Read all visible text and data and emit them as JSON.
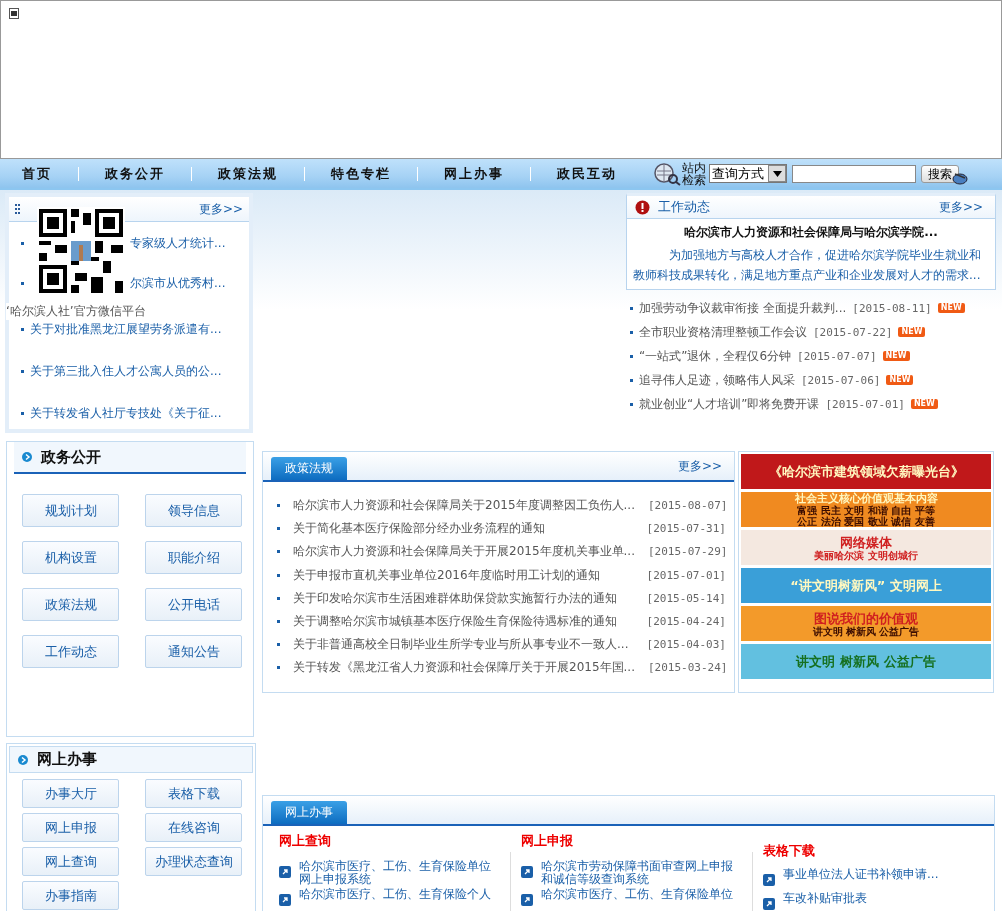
{
  "nav": {
    "items": [
      {
        "label": "首页",
        "selected": false
      },
      {
        "label": "政务公开",
        "selected": false
      },
      {
        "label": "政策法规",
        "selected": false
      },
      {
        "label": "特色专栏",
        "selected": false
      },
      {
        "label": "网上办事",
        "selected": false
      },
      {
        "label": "政民互动",
        "selected": false
      }
    ],
    "search": {
      "label": "站内检索",
      "select": "查询方式",
      "button": "搜索"
    }
  },
  "news": {
    "more": "更多>>",
    "qr_caption": "‘哈尔滨人社’官方微信平台",
    "items": [
      {
        "kind": "partly_hidden",
        "text": "专家级人才统计..."
      },
      {
        "kind": "partly_hidden",
        "text": "尔滨市从优秀村..."
      },
      {
        "kind": "link",
        "text": "关于对批准黑龙江展望劳务派遣有..."
      },
      {
        "kind": "link",
        "text": "关于第三批入住人才公寓人员的公..."
      },
      {
        "kind": "link",
        "text": "关于转发省人社厅专技处《关于征..."
      }
    ]
  },
  "work": {
    "title": "工作动态",
    "more": "更多>>",
    "headline": "哈尔滨市人力资源和社会保障局与哈尔滨学院...",
    "summary": "为加强地方与高校人才合作，促进哈尔滨学院毕业生就业和教师科技成果转化，满足地方重点产业和企业发展对人才的需求...",
    "items": [
      {
        "title": "加强劳动争议裁审衔接 全面提升裁判...",
        "date": "[2015-08-11]",
        "new": true,
        "badge": "NEW"
      },
      {
        "title": "全市职业资格清理整顿工作会议",
        "date": "[2015-07-22]",
        "new": true,
        "badge": "NEW"
      },
      {
        "title": "“一站式”退休，全程仅6分钟",
        "date": "[2015-07-07]",
        "new": true,
        "badge": "NEW"
      },
      {
        "title": "追寻伟人足迹，领略伟人风采",
        "date": "[2015-07-06]",
        "new": true,
        "badge": "NEW"
      },
      {
        "title": "就业创业“人才培训”即将免费开课",
        "date": "[2015-07-01]",
        "new": true,
        "badge": "NEW"
      }
    ]
  },
  "gov": {
    "title": "政务公开",
    "buttons": [
      "规划计划",
      "领导信息",
      "机构设置",
      "职能介绍",
      "政策法规",
      "公开电话",
      "工作动态",
      "通知公告"
    ]
  },
  "online_left": {
    "title": "网上办事",
    "buttons": [
      "办事大厅",
      "表格下载",
      "网上申报",
      "在线咨询",
      "网上查询",
      "办理状态查询",
      "办事指南"
    ]
  },
  "policy": {
    "tab": "政策法规",
    "more": "更多>>",
    "rows": [
      {
        "title": "哈尔滨市人力资源和社会保障局关于2015年度调整因工负伤人...",
        "date": "[2015-08-07]"
      },
      {
        "title": "关于简化基本医疗保险部分经办业务流程的通知",
        "date": "[2015-07-31]"
      },
      {
        "title": "哈尔滨市人力资源和社会保障局关于开展2015年度机关事业单...",
        "date": "[2015-07-29]"
      },
      {
        "title": "关于申报市直机关事业单位2016年度临时用工计划的通知",
        "date": "[2015-07-01]"
      },
      {
        "title": "关于印发哈尔滨市生活困难群体助保贷款实施暂行办法的通知",
        "date": "[2015-05-14]"
      },
      {
        "title": "关于调整哈尔滨市城镇基本医疗保险生育保险待遇标准的通知",
        "date": "[2015-04-24]"
      },
      {
        "title": "关于非普通高校全日制毕业生所学专业与所从事专业不一致人...",
        "date": "[2015-04-03]"
      },
      {
        "title": "关于转发《黑龙江省人力资源和社会保障厅关于开展2015年国...",
        "date": "[2015-03-24]"
      }
    ]
  },
  "banners": [
    {
      "color": "#c0181a",
      "lines": [
        "《哈尔滨市建筑领域欠薪曝光台》"
      ]
    },
    {
      "color": "#f08a20",
      "lines": [
        "社会主义核心价值观基本内容",
        "富强 民主 文明 和谐 自由 平等",
        "公正 法治 爱国 敬业 诚信 友善"
      ]
    },
    {
      "color": "#f4e8e0",
      "lines": [
        "网络媒体",
        "美丽哈尔滨 文明创城行"
      ]
    },
    {
      "color": "#3a9fd8",
      "lines": [
        "“讲文明树新风” 文明网上"
      ]
    },
    {
      "color": "#f39a2a",
      "lines": [
        "图说我们的价值观",
        "讲文明 树新风 公益广告"
      ]
    },
    {
      "color": "#62c0e0",
      "lines": [
        "讲文明 树新风 公益广告"
      ]
    }
  ],
  "online": {
    "tab": "网上办事",
    "columns": [
      {
        "title": "网上查询",
        "items": [
          "哈尔滨市医疗、工伤、生育保险单位网上申报系统",
          "哈尔滨市医疗、工伤、生育保险个人"
        ]
      },
      {
        "title": "网上申报",
        "items": [
          "哈尔滨市劳动保障书面审查网上申报和诚信等级查询系统",
          "哈尔滨市医疗、工伤、生育保险单位"
        ]
      },
      {
        "title": "表格下载",
        "items": [
          "事业单位法人证书补领申请...",
          "车改补贴审批表"
        ]
      }
    ]
  }
}
